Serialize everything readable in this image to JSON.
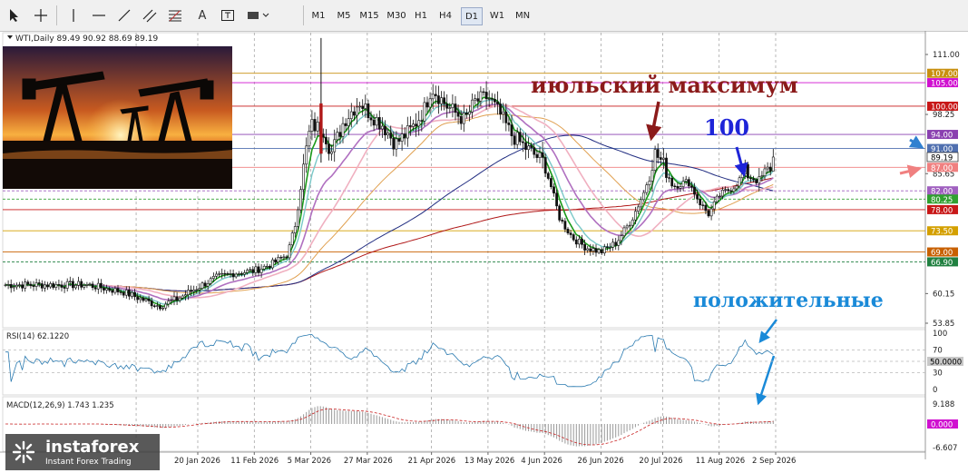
{
  "toolbar": {
    "icons": [
      "cursor-icon",
      "crosshair-icon",
      "vertical-line-icon",
      "horizontal-line-icon",
      "trendline-icon",
      "equidistant-channel-icon",
      "fibonacci-icon",
      "text-icon",
      "text-label-icon",
      "shapes-icon"
    ],
    "text_tool": "A",
    "timeframes": [
      "M1",
      "M5",
      "M15",
      "M30",
      "H1",
      "H4",
      "D1",
      "W1",
      "MN"
    ],
    "active_timeframe": "D1"
  },
  "symbol_label": "WTI,Daily  89.49 90.92 88.69 89.19",
  "rsi_label": "RSI(14) 62.1220",
  "macd_label": "MACD(12,26,9) 1.743 1.235",
  "annotations": {
    "july_max": "июльский максимум",
    "hundred": "100",
    "positive": "положительные"
  },
  "logo": {
    "name": "instaforex",
    "tagline": "Instant Forex Trading"
  },
  "colors": {
    "candle": "#111111",
    "ema_fast": "#1a9a1a",
    "ema_mid": "#7ac8c8",
    "ma_violet": "#b070c0",
    "ma_pink": "#f0b0c0",
    "ma_orange": "#e0a050",
    "ma_navy": "#202c80",
    "ma_red": "#b01818",
    "annotation_dark": "#8b1a1a",
    "annotation_blue": "#1e24d8",
    "annotation_cyan": "#1a8ad8",
    "rsi_line": "#2a7ab0"
  },
  "chart_data": {
    "type": "candlestick",
    "symbol": "WTI",
    "timeframe": "Daily",
    "last_ohlc": {
      "open": 89.49,
      "high": 90.92,
      "low": 88.69,
      "close": 89.19
    },
    "price_axis_labels": [
      "111.00",
      "98.25",
      "85.65",
      "60.15",
      "53.85"
    ],
    "level_labels": [
      {
        "value": 107.0,
        "label": "107.00",
        "color": "#c89010"
      },
      {
        "value": 105.0,
        "label": "105.00",
        "color": "#d010d0"
      },
      {
        "value": 100.0,
        "label": "100.00",
        "color": "#c81818"
      },
      {
        "value": 94.0,
        "label": "94.00",
        "color": "#8a40b0"
      },
      {
        "value": 91.0,
        "label": "91.00",
        "color": "#5070b0"
      },
      {
        "value": 89.19,
        "label": "89.19",
        "color": "#101010"
      },
      {
        "value": 87.0,
        "label": "87.00",
        "color": "#f08080"
      },
      {
        "value": 82.0,
        "label": "82.00",
        "color": "#a060c0"
      },
      {
        "value": 80.25,
        "label": "80.25",
        "color": "#30a030"
      },
      {
        "value": 78.0,
        "label": "78.00",
        "color": "#c81818"
      },
      {
        "value": 73.5,
        "label": "73.50",
        "color": "#d4a000"
      },
      {
        "value": 69.0,
        "label": "69.00",
        "color": "#c86000"
      },
      {
        "value": 66.9,
        "label": "66.90",
        "color": "#208040"
      }
    ],
    "x_labels": [
      "20 Jan 2026",
      "11 Feb 2026",
      "5 Mar 2026",
      "27 Mar 2026",
      "21 Apr 2026",
      "13 May 2026",
      "4 Jun 2026",
      "26 Jun 2026",
      "20 Jul 2026",
      "11 Aug 2026",
      "2 Sep 2026"
    ],
    "closes_key": [
      [
        "2025-12-08",
        62.0
      ],
      [
        "2025-12-22",
        60.5
      ],
      [
        "2026-01-05",
        57.5
      ],
      [
        "2026-01-12",
        59.0
      ],
      [
        "2026-01-20",
        61.5
      ],
      [
        "2026-01-27",
        63.5
      ],
      [
        "2026-02-03",
        64.5
      ],
      [
        "2026-02-11",
        65.0
      ],
      [
        "2026-02-18",
        66.5
      ],
      [
        "2026-02-24",
        68.5
      ],
      [
        "2026-02-27",
        75.0
      ],
      [
        "2026-03-03",
        90.0
      ],
      [
        "2026-03-05",
        96.0
      ],
      [
        "2026-03-10",
        95.0
      ],
      [
        "2026-03-13",
        90.0
      ],
      [
        "2026-03-18",
        97.0
      ],
      [
        "2026-03-24",
        101.0
      ],
      [
        "2026-03-27",
        99.0
      ],
      [
        "2026-04-02",
        96.0
      ],
      [
        "2026-04-07",
        92.0
      ],
      [
        "2026-04-13",
        95.0
      ],
      [
        "2026-04-18",
        99.0
      ],
      [
        "2026-04-21",
        104.0
      ],
      [
        "2026-04-27",
        100.0
      ],
      [
        "2026-05-04",
        97.0
      ],
      [
        "2026-05-08",
        101.0
      ],
      [
        "2026-05-13",
        102.0
      ],
      [
        "2026-05-18",
        98.0
      ],
      [
        "2026-05-22",
        94.0
      ],
      [
        "2026-05-28",
        91.0
      ],
      [
        "2026-06-04",
        88.0
      ],
      [
        "2026-06-10",
        76.0
      ],
      [
        "2026-06-15",
        72.0
      ],
      [
        "2026-06-20",
        70.0
      ],
      [
        "2026-06-26",
        69.0
      ],
      [
        "2026-07-02",
        71.0
      ],
      [
        "2026-07-08",
        76.0
      ],
      [
        "2026-07-13",
        82.0
      ],
      [
        "2026-07-17",
        90.0
      ],
      [
        "2026-07-20",
        88.0
      ],
      [
        "2026-07-24",
        83.0
      ],
      [
        "2026-07-30",
        84.0
      ],
      [
        "2026-08-04",
        79.0
      ],
      [
        "2026-08-07",
        77.0
      ],
      [
        "2026-08-11",
        81.0
      ],
      [
        "2026-08-17",
        83.0
      ],
      [
        "2026-08-21",
        86.0
      ],
      [
        "2026-08-26",
        84.0
      ],
      [
        "2026-08-31",
        87.0
      ],
      [
        "2026-09-02",
        89.19
      ]
    ],
    "rsi": {
      "period": 14,
      "value": 62.122,
      "axis_labels": [
        "100",
        "70",
        "50",
        "30",
        "0"
      ],
      "levels": [
        70,
        50,
        30
      ],
      "current_label": "50.0000"
    },
    "macd": {
      "fast": 12,
      "slow": 26,
      "signal": 9,
      "main": 1.743,
      "signal_value": 1.235,
      "axis_labels": [
        "9.188",
        "0.000",
        "-6.607"
      ],
      "current_label": "0.000"
    }
  }
}
